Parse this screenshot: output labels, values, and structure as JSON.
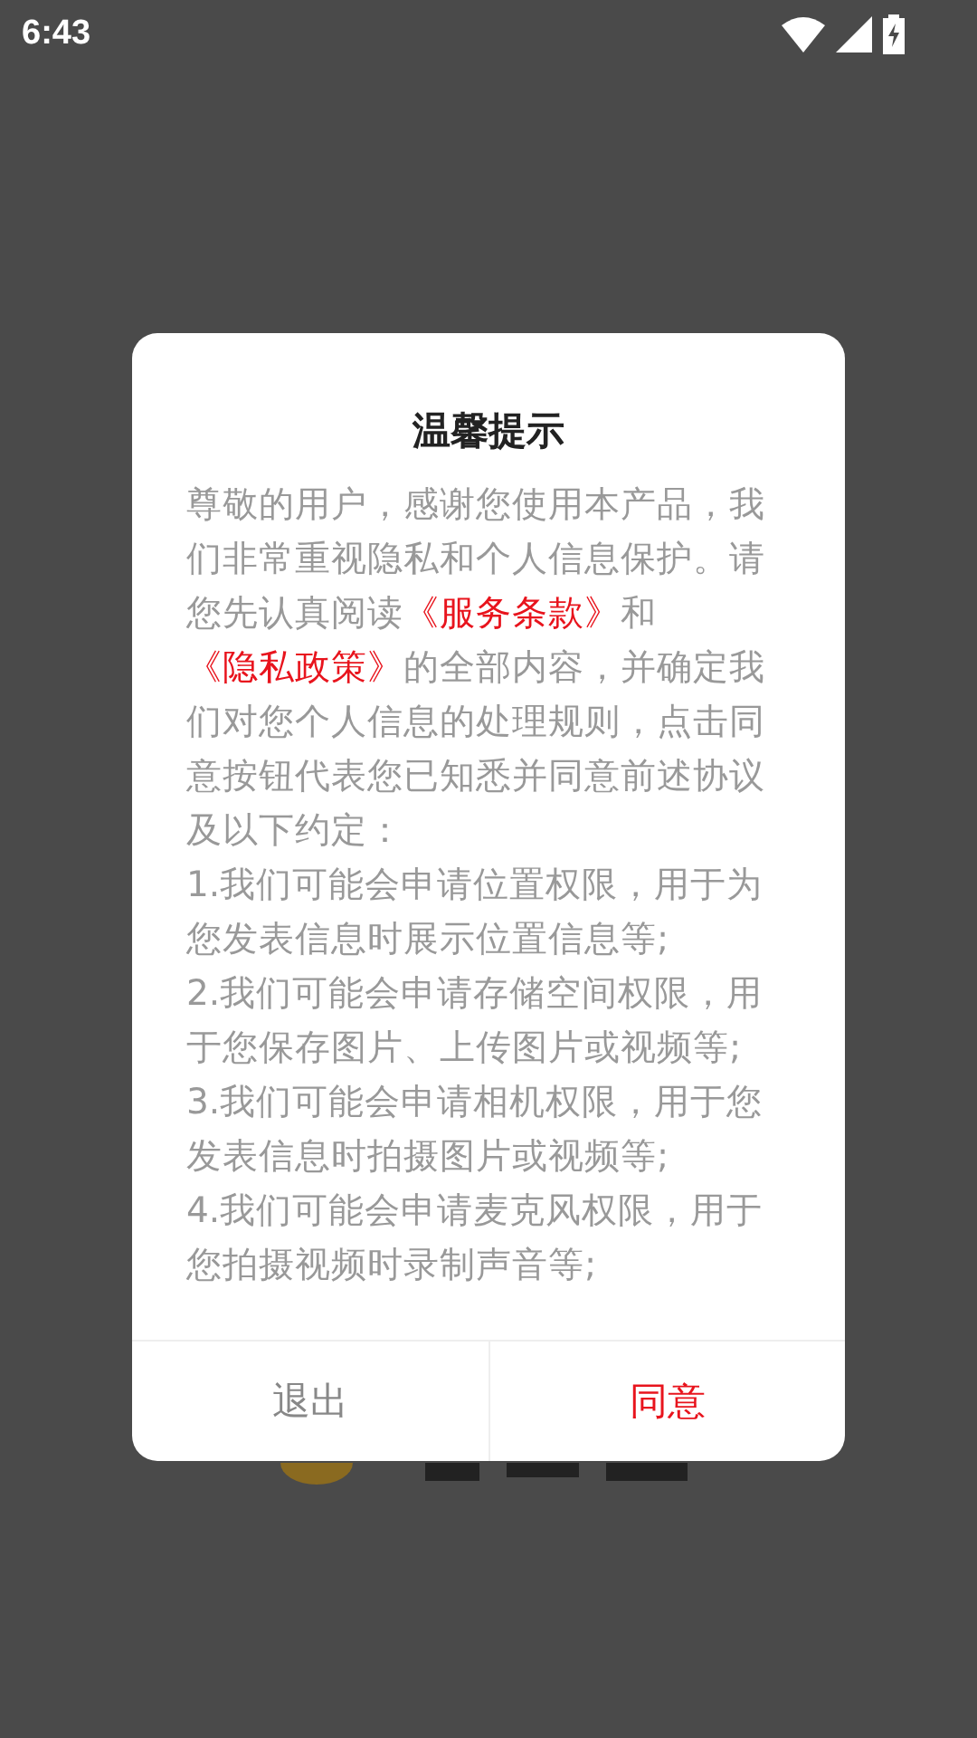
{
  "status_bar": {
    "time": "6:43"
  },
  "dialog": {
    "title": "温馨提示",
    "intro": [
      {
        "kind": "text",
        "text": "尊敬的用户，感谢您使用本产品，我们非常重视隐私和个人信息保护。请您先认真阅读"
      },
      {
        "kind": "link",
        "text": "《服务条款》"
      },
      {
        "kind": "text",
        "text": "和"
      },
      {
        "kind": "link",
        "text": "《隐私政策》"
      },
      {
        "kind": "text",
        "text": "的全部内容，并确定我们对您个人信息的处理规则，点击同意按钮代表您已知悉并同意前述协议及以下约定："
      }
    ],
    "items": [
      "1.我们可能会申请位置权限，用于为您发表信息时展示位置信息等;",
      "2.我们可能会申请存储空间权限，用于您保存图片、上传图片或视频等;",
      "3.我们可能会申请相机权限，用于您发表信息时拍摄图片或视频等;",
      "4.我们可能会申请麦克风权限，用于您拍摄视频时录制声音等;"
    ],
    "buttons": [
      {
        "label": "退出",
        "kind": "cancel"
      },
      {
        "label": "同意",
        "kind": "confirm"
      }
    ]
  }
}
